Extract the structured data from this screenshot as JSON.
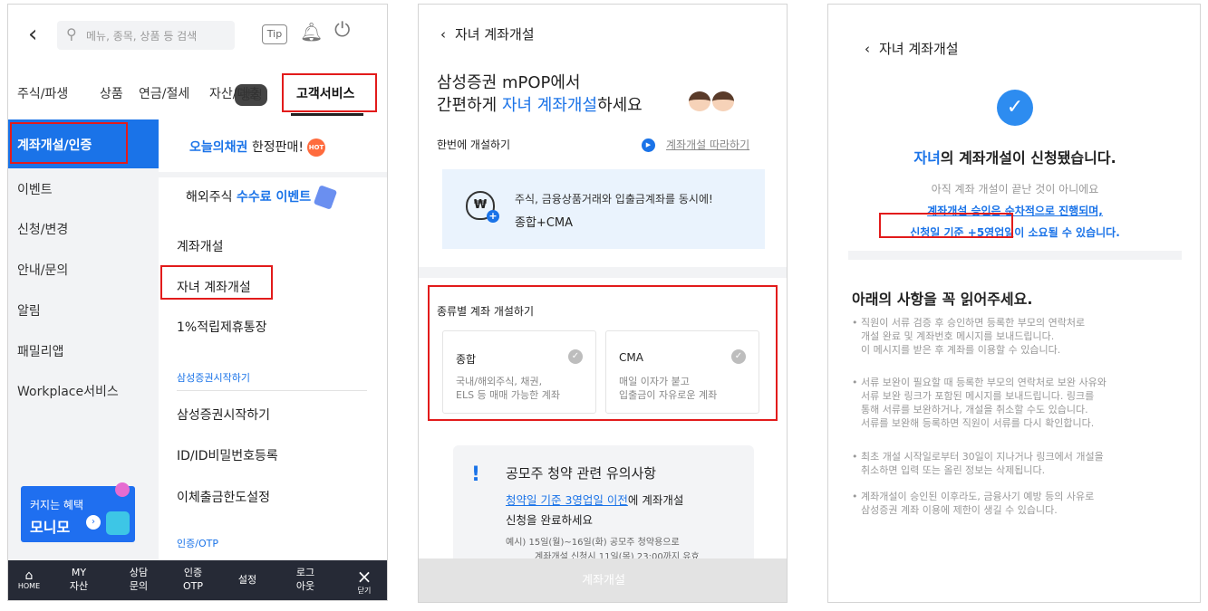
{
  "panel1": {
    "search_placeholder": "메뉴, 종목, 상품 등 검색",
    "tip_label": "Tip",
    "tabs": [
      "주식/파생",
      "상품",
      "연금/절세",
      "자산/대출",
      "고객서비스"
    ],
    "rank_badge": "랭킹",
    "left_menu": [
      "계좌개설/인증",
      "이벤트",
      "신청/변경",
      "안내/문의",
      "알림",
      "패밀리앱",
      "Workplace서비스"
    ],
    "promo1_blue": "오늘의채권",
    "promo1_rest": " 한정판매!",
    "hot_label": "HOT",
    "promo2_a": "해외주식 ",
    "promo2_blue": "수수료 이벤트",
    "items_a": [
      "계좌개설",
      "자녀 계좌개설",
      "1%적립제휴통장"
    ],
    "section1": "삼성증권시작하기",
    "items_b": [
      "삼성증권시작하기",
      "ID/ID비밀번호등록",
      "이체출금한도설정"
    ],
    "section2": "인증/OTP",
    "banner_line1": "커지는 혜택",
    "banner_line2": "모니모",
    "bottom_nav": {
      "home": "HOME",
      "my": [
        "MY",
        "자산"
      ],
      "consult": [
        "상담",
        "문의"
      ],
      "auth": [
        "인증",
        "OTP"
      ],
      "settings": "설정",
      "logout": [
        "로그",
        "아웃"
      ],
      "close": "닫기"
    }
  },
  "panel2": {
    "header": "자녀 계좌개설",
    "title_line1": "삼성증권 mPOP에서",
    "title_line2_a": "간편하게 ",
    "title_line2_blue": "자녀 계좌개설",
    "title_line2_b": "하세요",
    "open_once": "한번에 개설하기",
    "follow_link": "계좌개설 따라하기",
    "card_line1": "주식, 금융상품거래와 입출금계좌를 동시에!",
    "card_line2": "종합+CMA",
    "type_title": "종류별 계좌 개설하기",
    "type_cards": [
      {
        "title": "종합",
        "line1": "국내/해외주식, 채권,",
        "line2": "ELS 등 매매 가능한 계좌"
      },
      {
        "title": "CMA",
        "line1": "매일 이자가 붙고",
        "line2": "입출금이 자유로운 계좌"
      }
    ],
    "notice_title": "공모주 청약 관련 유의사항",
    "notice_link": "청약일 기준 3영업일 이전",
    "notice_after_link": "에 계좌개설",
    "notice_line2": "신청을 완료하세요",
    "notice_ex1": "예시) 15일(월)~16일(화) 공모주 청약용으로",
    "notice_ex2": "계좌개설 신청시 11일(목) 23:00까지 유효",
    "bottom_button": "계좌개설"
  },
  "panel3": {
    "header": "자녀 계좌개설",
    "success_blue": "자녀",
    "success_rest": "의 계좌개설이 신청됐습니다.",
    "gray_line": "아직 계좌 개설이 끝난 것이 아니에요",
    "blue_line1": "계좌개설 승인은 순차적으로 진행되며,",
    "blue_line2": "신청일 기준 +5영업일이 소요될 수 있습니다.",
    "read_title": "아래의 사항을 꼭 읽어주세요.",
    "bullets": [
      [
        "직원이 서류 검증 후 승인하면 등록한 부모의 연락처로",
        "개설 완료 및 계좌번호 메시지를 보내드립니다.",
        "이 메시지를 받은 후 계좌를 이용할 수 있습니다."
      ],
      [
        "서류 보완이 필요할 때 등록한 부모의 연락처로 보완 사유와",
        "서류 보완 링크가 포함된 메시지를 보내드립니다. 링크를",
        "통해 서류를 보완하거나, 개설을 취소할 수도 있습니다.",
        "서류를 보완해 등록하면 직원이 서류를 다시 확인합니다."
      ],
      [
        "최초 개설 시작일로부터 30일이 지나거나 링크에서 개설을",
        "취소하면 입력 또는 올린 정보는 삭제됩니다."
      ],
      [
        "계좌개설이 승인된 이후라도, 금융사기 예방 등의 사유로",
        "삼성증권 계좌 이용에 제한이 생길 수 있습니다."
      ]
    ]
  },
  "colors": {
    "accent": "#1a73e8",
    "highlight": "#e21b1b",
    "nav_dark": "#262a36"
  }
}
